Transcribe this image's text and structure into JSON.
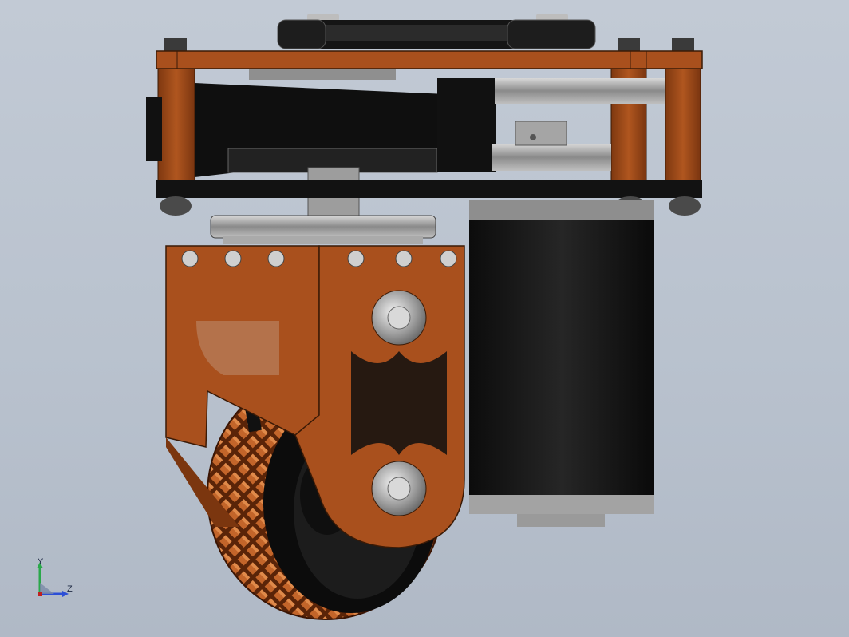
{
  "viewport": {
    "background_top": "#c2cad5",
    "background_bottom": "#b0b9c6"
  },
  "model": {
    "frame_color": "#a9501d",
    "plate_color": "#111111",
    "motor_color": "#151515",
    "tread_color": "#b35a24",
    "metal_color": "#9c9c9c"
  },
  "triad": {
    "y_label": "Y",
    "z_label": "Z",
    "y_axis_color": "#2aa84a",
    "z_axis_color": "#2d4fd6"
  }
}
